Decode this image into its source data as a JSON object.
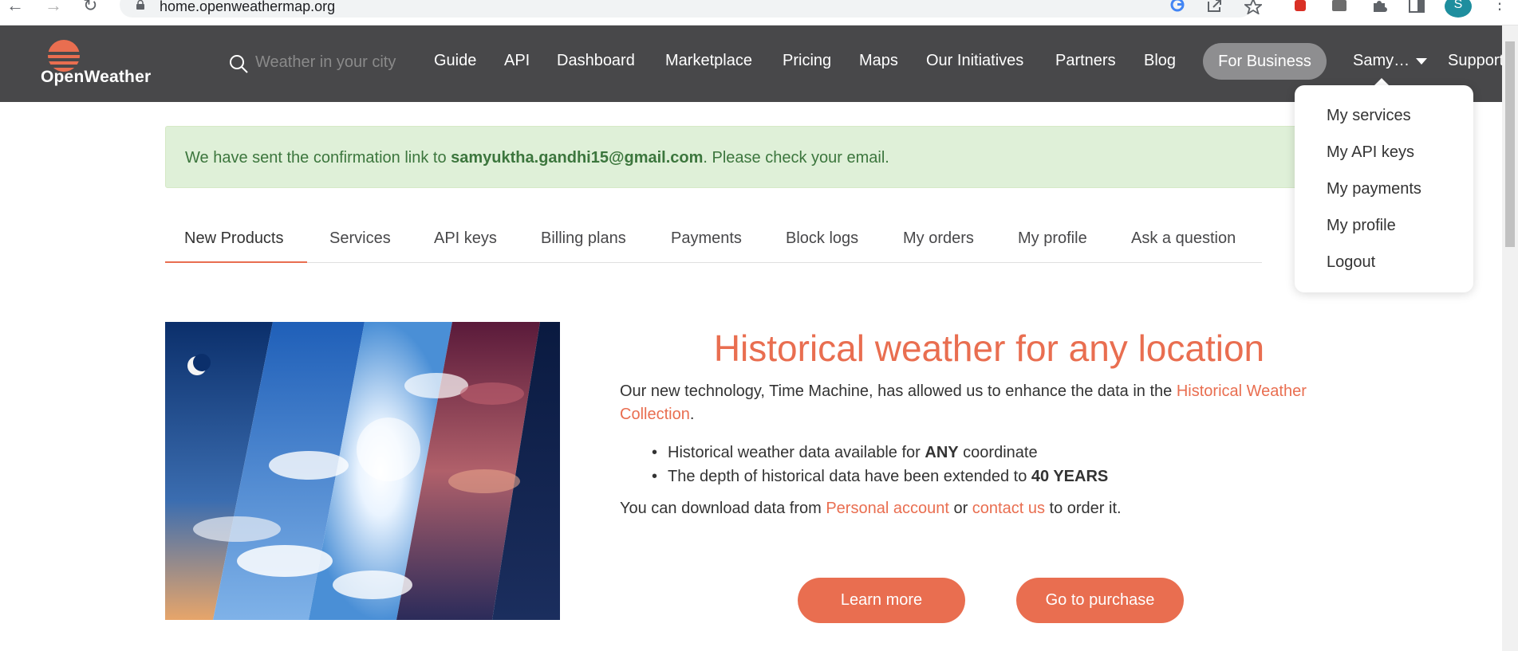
{
  "browser": {
    "url": "home.openweathermap.org",
    "profile_initial": "S"
  },
  "header": {
    "logo_text": "OpenWeather",
    "search_placeholder": "Weather in your city",
    "nav": [
      {
        "label": "Guide"
      },
      {
        "label": "API"
      },
      {
        "label": "Dashboard"
      },
      {
        "label": "Marketplace"
      },
      {
        "label": "Pricing"
      },
      {
        "label": "Maps"
      },
      {
        "label": "Our Initiatives"
      },
      {
        "label": "Partners"
      },
      {
        "label": "Blog"
      }
    ],
    "for_business": "For Business",
    "user": "Samy…",
    "support": "Support"
  },
  "dropdown": {
    "items": [
      "My services",
      "My API keys",
      "My payments",
      "My profile",
      "Logout"
    ]
  },
  "alert": {
    "prefix": "We have sent the confirmation link to ",
    "email": "samyuktha.gandhi15@gmail.com",
    "suffix": ". Please check your email."
  },
  "tabs": {
    "items": [
      "New Products",
      "Services",
      "API keys",
      "Billing plans",
      "Payments",
      "Block logs",
      "My orders",
      "My profile",
      "Ask a question"
    ],
    "active": "New Products"
  },
  "content": {
    "headline": "Historical weather for any location",
    "intro_text": "Our new technology, Time Machine, has allowed us to enhance the data in the ",
    "intro_link": "Historical Weather Collection",
    "intro_end": ".",
    "bullet1_text": "Historical weather data available for ",
    "bullet1_bold": "ANY",
    "bullet1_end": " coordinate",
    "bullet2_text": "The depth of historical data have been extended to ",
    "bullet2_bold": "40 YEARS",
    "download_prefix": "You can download data from ",
    "download_link1": "Personal account",
    "download_or": " or ",
    "download_link2": "contact us",
    "download_suffix": " to order it.",
    "learn_more": "Learn more",
    "go_to_purchase": "Go to purchase"
  },
  "colors": {
    "accent": "#e96e50",
    "header_bg": "#48484a",
    "alert_bg": "#dff0d8",
    "alert_text": "#3c763d"
  }
}
